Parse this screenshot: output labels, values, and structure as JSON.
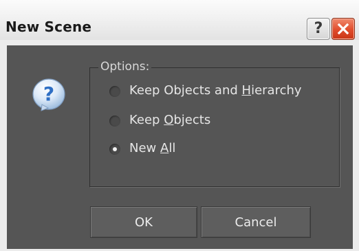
{
  "window": {
    "title": "New Scene"
  },
  "titlebar": {
    "help_label": "?",
    "help_icon": "help-icon",
    "close_icon": "close-icon"
  },
  "dialog": {
    "icon": "question-icon",
    "icon_glyph": "?",
    "group_label": "Options:",
    "options": [
      {
        "label_pre": "Keep Objects and ",
        "label_ul": "H",
        "label_post": "ierarchy",
        "selected": false
      },
      {
        "label_pre": "Keep ",
        "label_ul": "O",
        "label_post": "bjects",
        "selected": false
      },
      {
        "label_pre": "New ",
        "label_ul": "A",
        "label_post": "ll",
        "selected": true
      }
    ],
    "ok_label": "OK",
    "cancel_label": "Cancel"
  },
  "colors": {
    "panel_bg": "#555555",
    "text": "#e6e6e6",
    "close_red": "#e04c2c",
    "question_blue": "#3a7fd0"
  }
}
